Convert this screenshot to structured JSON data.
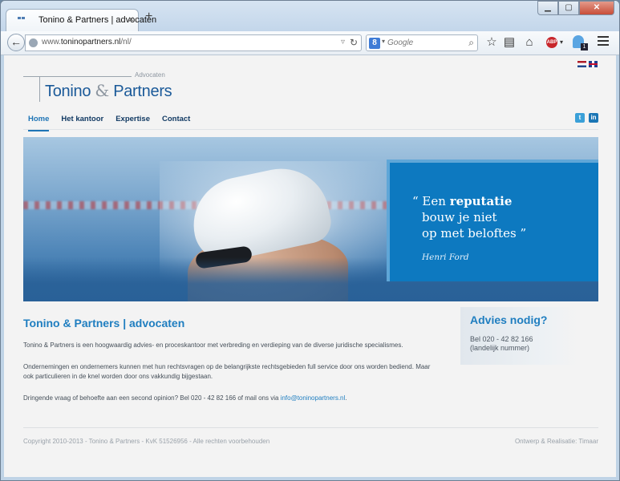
{
  "browser": {
    "tab_title": "Tonino & Partners | advocaten",
    "new_tab": "+",
    "close_tab": "×",
    "url_prefix": "www.",
    "url_domain": "toninopartners.nl",
    "url_path": "/nl/",
    "search_engine": "Google",
    "search_engine_badge": "8",
    "search_placeholder": "Google",
    "ghostery_count": "1"
  },
  "window_controls": {
    "minimize": "▁",
    "maximize": "▢",
    "close": "✕"
  },
  "site": {
    "logo_tagline": "Advocaten",
    "logo_name_a": "Tonino",
    "logo_amp": "&",
    "logo_name_b": "Partners",
    "languages": [
      "Nederlands",
      "English"
    ],
    "nav": [
      "Home",
      "Het kantoor",
      "Expertise",
      "Contact"
    ],
    "active_nav": "Home",
    "social": {
      "twitter": "t",
      "linkedin": "in"
    }
  },
  "hero": {
    "quote_line1_a": "“ Een ",
    "quote_line1_b": "reputatie",
    "quote_line2": "bouw je niet",
    "quote_line3": "op met beloftes ”",
    "author": "Henri Ford"
  },
  "content": {
    "title": "Tonino & Partners | advocaten",
    "p1": "Tonino & Partners is een hoogwaardig advies- en proceskantoor met verbreding en verdieping van de diverse juridische specialismes.",
    "p2": "Ondernemingen en ondernemers kunnen met hun rechtsvragen op de belangrijkste rechtsgebieden full service door ons worden bediend. Maar ook particulieren in de knel worden door ons vakkundig bijgestaan.",
    "p3": "Dringende vraag of behoefte aan een second opinion? Bel 020 - 42 82 166 of mail ons via ",
    "email": "info@toninopartners.nl",
    "p3_end": "."
  },
  "sidebar": {
    "title": "Advies nodig?",
    "phone": "Bel 020 - 42 82 166",
    "sub": "(landelijk nummer)"
  },
  "footer": {
    "copyright": "Copyright 2010-2013 - Tonino & Partners - KvK 51526956 - Alle rechten voorbehouden",
    "credit": "Ontwerp & Realisatie: Timaar"
  },
  "colors": {
    "brand_blue": "#1f7ec0",
    "nav_dark": "#123a63",
    "quote_box": "#0d79c0"
  }
}
